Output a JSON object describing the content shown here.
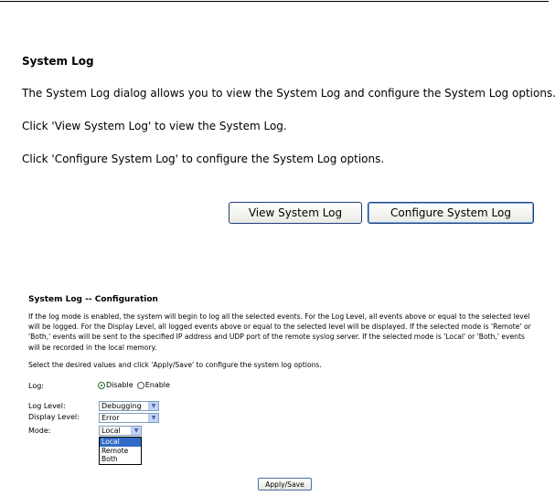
{
  "system_log": {
    "title": "System Log",
    "description": "The System Log dialog allows you to view the System Log and configure the System Log options.",
    "view_hint": "Click 'View System Log' to view the System Log.",
    "configure_hint": "Click 'Configure System Log' to configure the System Log options.",
    "view_button": "View System Log",
    "configure_button": "Configure System Log"
  },
  "configuration": {
    "title": "System Log -- Configuration",
    "description": "If the log mode is enabled, the system will begin to log all the selected events. For the Log Level, all events above or equal to the selected level will be logged. For the Display Level, all logged events above or equal to the selected level will be displayed. If the selected mode is 'Remote' or 'Both,' events will be sent to the specified IP address and UDP port of the remote syslog server. If the selected mode is 'Local' or 'Both,' events will be recorded in the local memory.",
    "instruction": "Select the desired values and click 'Apply/Save' to configure the system log options.",
    "log_label": "Log:",
    "log_options": [
      "Disable",
      "Enable"
    ],
    "log_selected": "Disable",
    "log_level_label": "Log Level:",
    "log_level_value": "Debugging",
    "display_level_label": "Display Level:",
    "display_level_value": "Error",
    "mode_label": "Mode:",
    "mode_value": "Local",
    "mode_options": [
      "Local",
      "Remote",
      "Both"
    ],
    "apply_button": "Apply/Save"
  },
  "colors": {
    "button_border": "#1c3f7a",
    "select_highlight": "#316ac5",
    "radio_color": "#2a6f2a"
  }
}
